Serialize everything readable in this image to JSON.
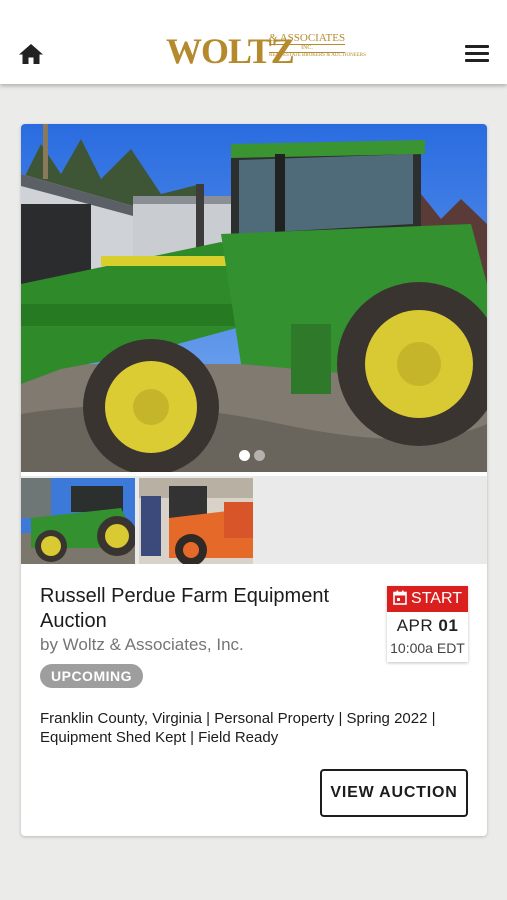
{
  "header": {
    "logo_main": "WOLTZ",
    "logo_amp": "& ASSOCIATES",
    "logo_inc": "INC.",
    "logo_sub": "REAL ESTATE BROKERS & AUCTIONEERS",
    "home_icon": "home-icon",
    "menu_icon": "hamburger-menu-icon"
  },
  "auction": {
    "title": "Russell Perdue Farm Equipment Auction",
    "byline": "by Woltz & Associates, Inc.",
    "status": "UPCOMING",
    "start_label": "START",
    "start_month": "APR",
    "start_day": "01",
    "start_time": "10:00a EDT",
    "description": "Franklin County, Virginia | Personal Property | Spring 2022 | Equipment Shed Kept | Field Ready",
    "view_button": "VIEW AUCTION"
  },
  "gallery": {
    "slide_count": 2,
    "active_slide": 1,
    "photos": [
      "green tractor",
      "orange tractor"
    ]
  },
  "colors": {
    "brand_gold": "#b48a2c",
    "start_red": "#d9201f",
    "badge_grey": "#9e9e9e"
  }
}
